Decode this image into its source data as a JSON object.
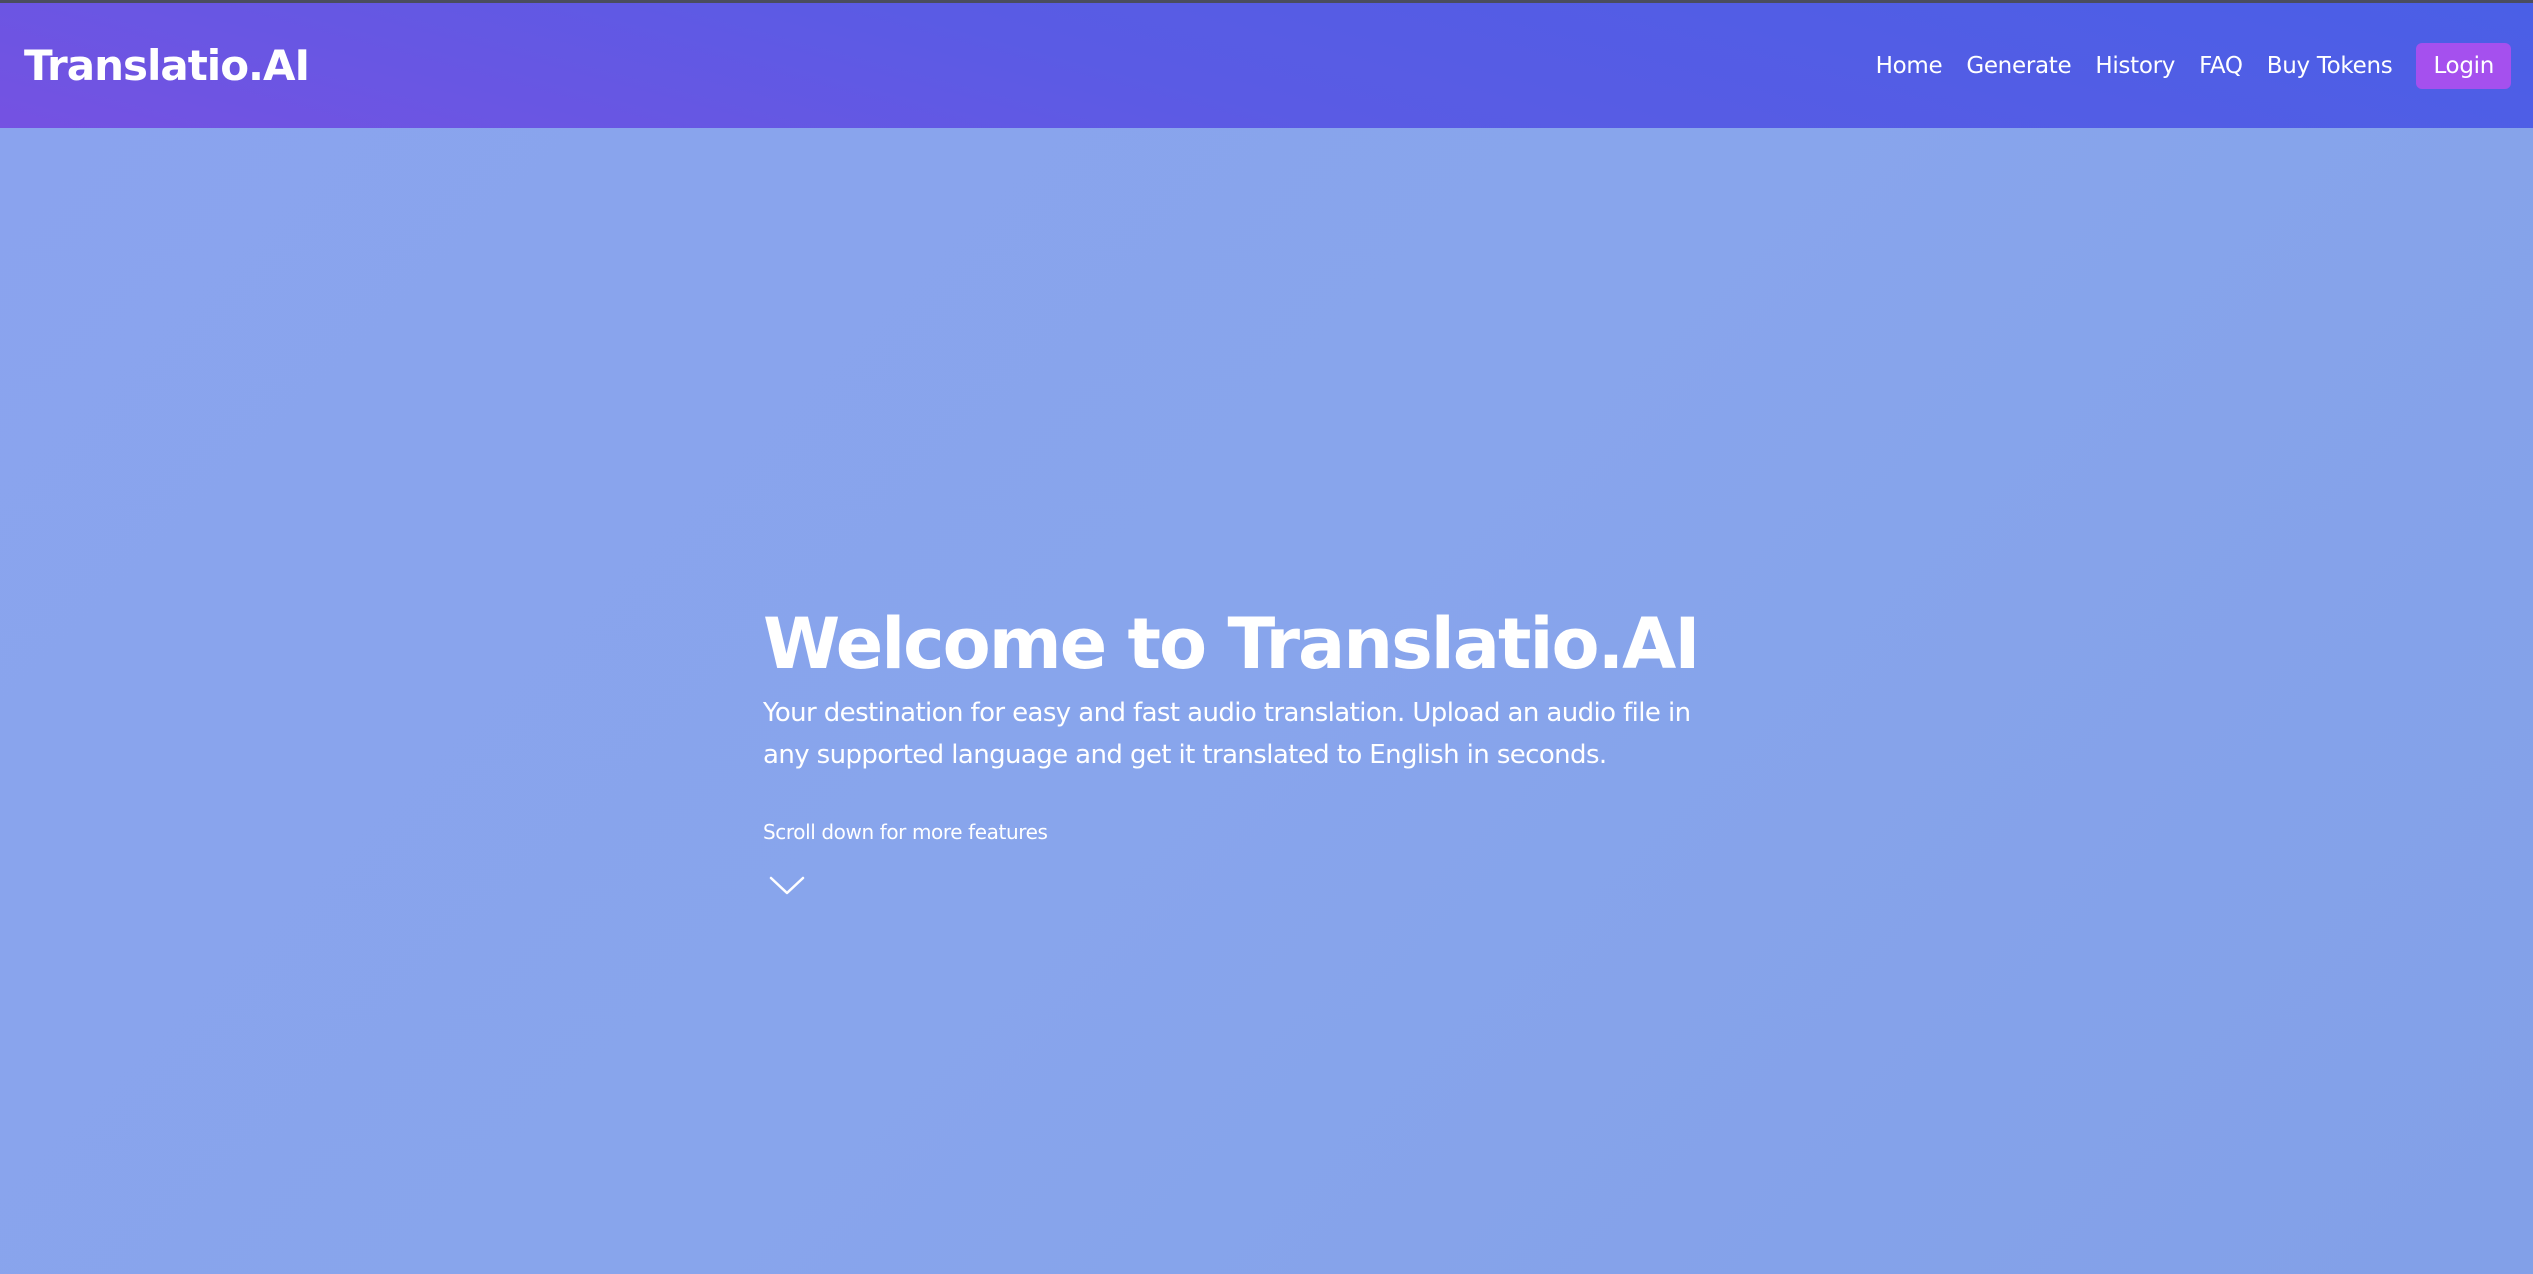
{
  "navbar": {
    "brand": "Translatio.AI",
    "links": [
      {
        "label": "Home"
      },
      {
        "label": "Generate"
      },
      {
        "label": "History"
      },
      {
        "label": "FAQ"
      },
      {
        "label": "Buy Tokens"
      }
    ],
    "login_label": "Login"
  },
  "hero": {
    "title": "Welcome to Translatio.AI",
    "subtitle": "Your destination for easy and fast audio translation. Upload an audio file in any supported language and get it translated to English in seconds.",
    "scroll_hint": "Scroll down for more features",
    "scroll_icon": "chevron-down-icon"
  },
  "colors": {
    "navbar_start": "#4a5fe6",
    "navbar_end": "#7552e2",
    "hero_background": "#88a5ec",
    "login_button": "#a550ee",
    "text": "#ffffff"
  }
}
